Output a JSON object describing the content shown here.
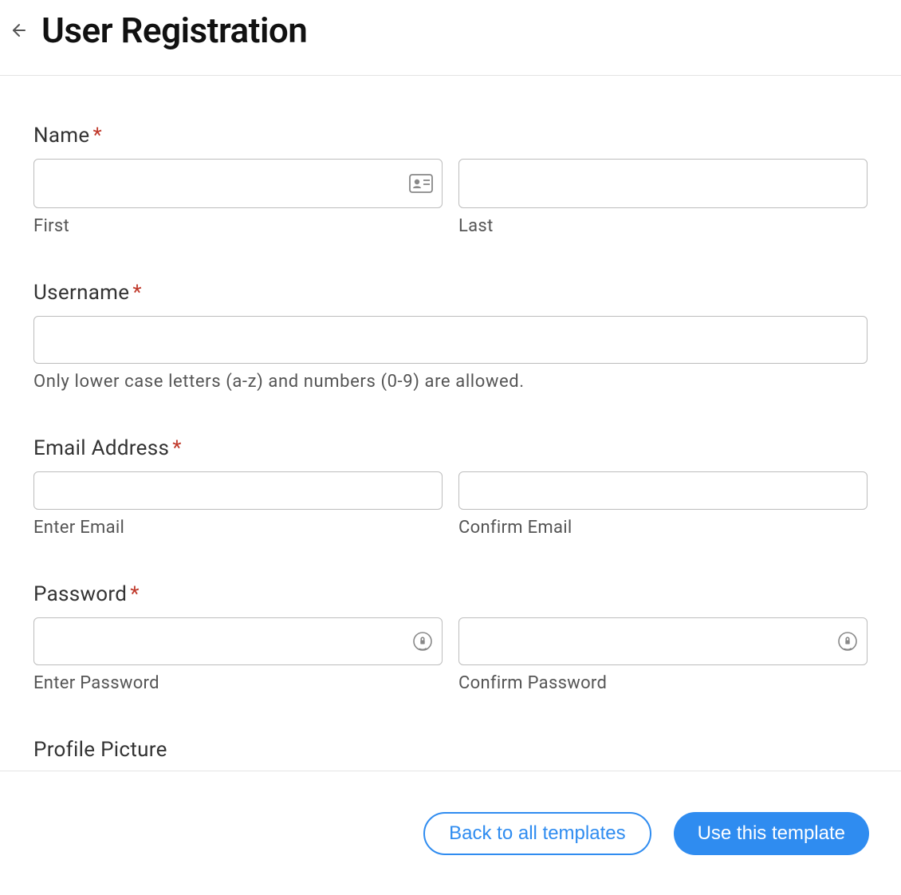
{
  "header": {
    "title": "User Registration"
  },
  "form": {
    "name": {
      "label": "Name",
      "first_sub": "First",
      "last_sub": "Last"
    },
    "username": {
      "label": "Username",
      "helper": "Only lower case letters (a-z) and numbers (0-9) are allowed."
    },
    "email": {
      "label": "Email Address",
      "enter_sub": "Enter Email",
      "confirm_sub": "Confirm Email"
    },
    "password": {
      "label": "Password",
      "enter_sub": "Enter Password",
      "confirm_sub": "Confirm Password"
    },
    "profile_picture": {
      "label": "Profile Picture"
    }
  },
  "footer": {
    "back_label": "Back to all templates",
    "use_label": "Use this template"
  }
}
